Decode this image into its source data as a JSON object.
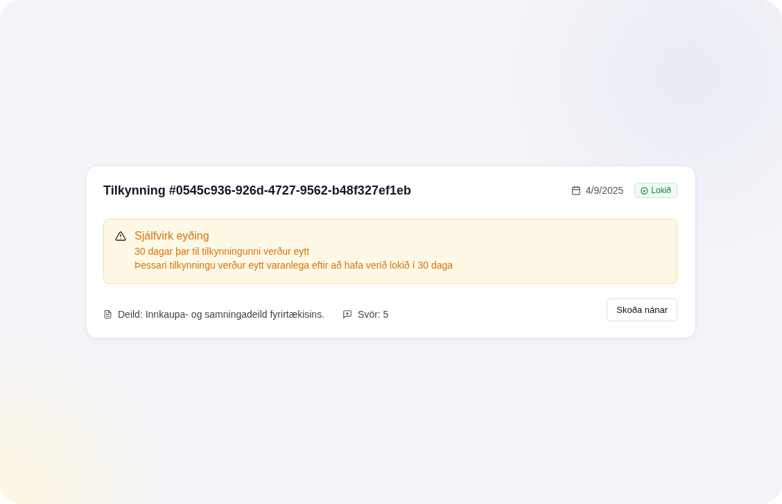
{
  "notice": {
    "title": "Tilkynning #0545c936-926d-4727-9562-b48f327ef1eb",
    "date": "4/9/2025",
    "status": {
      "kind": "done",
      "label": "Lokið"
    },
    "alert": {
      "title": "Sjálfvirk eyðing",
      "lines": [
        "30 dagar þar til tilkynningunni verður eytt",
        "Þessari tilkynningu verður eytt varanlega eftir að hafa verið lokið í 30 daga"
      ]
    },
    "department": "Deild: Innkaupa- og samningadeild fyrirtækisins.",
    "replies": "Svör: 5",
    "button": "Skoða nánar"
  }
}
